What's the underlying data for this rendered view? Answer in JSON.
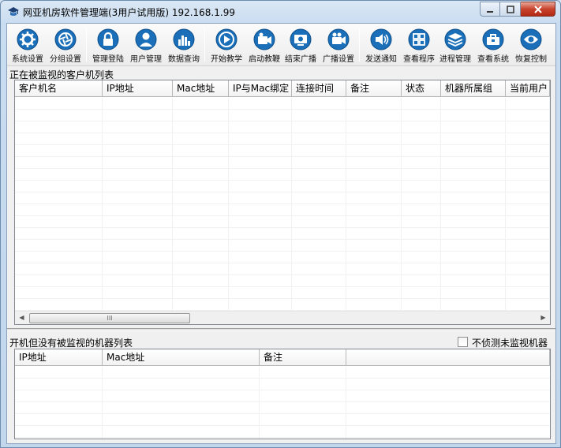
{
  "window": {
    "title": "网亚机房软件管理端(3用户试用版) 192.168.1.99",
    "min_label": "▭",
    "max_label": "▢",
    "close_label": "✕"
  },
  "toolbar": {
    "items": [
      {
        "label": "系统设置",
        "icon": "gear-icon"
      },
      {
        "label": "分组设置",
        "icon": "aperture-icon"
      },
      {
        "label": "管理登陆",
        "icon": "lock-icon"
      },
      {
        "label": "用户管理",
        "icon": "user-icon"
      },
      {
        "label": "数据查询",
        "icon": "bar-chart-icon"
      },
      {
        "label": "开始教学",
        "icon": "play-icon"
      },
      {
        "label": "启动教鞭",
        "icon": "camera-icon"
      },
      {
        "label": "结束广播",
        "icon": "screen-icon"
      },
      {
        "label": "广播设置",
        "icon": "video-camera-icon"
      },
      {
        "label": "发送通知",
        "icon": "speaker-icon"
      },
      {
        "label": "查看程序",
        "icon": "grid-icon"
      },
      {
        "label": "进程管理",
        "icon": "layers-icon"
      },
      {
        "label": "查看系统",
        "icon": "toolbox-icon"
      },
      {
        "label": "恢复控制",
        "icon": "eye-icon"
      }
    ]
  },
  "monitored_section": {
    "label": "正在被监视的客户机列表",
    "columns": [
      "客户机名",
      "IP地址",
      "Mac地址",
      "IP与Mac绑定",
      "连接时间",
      "备注",
      "状态",
      "机器所属组",
      "当前用户"
    ],
    "scroll_thumb_label": "III"
  },
  "unmonitored_section": {
    "label": "开机但没有被监视的机器列表",
    "checkbox_label": "不侦测未监视机器",
    "checkbox_checked": false,
    "columns": [
      "IP地址",
      "Mac地址",
      "备注"
    ]
  },
  "colors": {
    "icon_primary": "#1a6fb8",
    "icon_dark": "#0d4f8c",
    "close_button": "#c7432c"
  }
}
